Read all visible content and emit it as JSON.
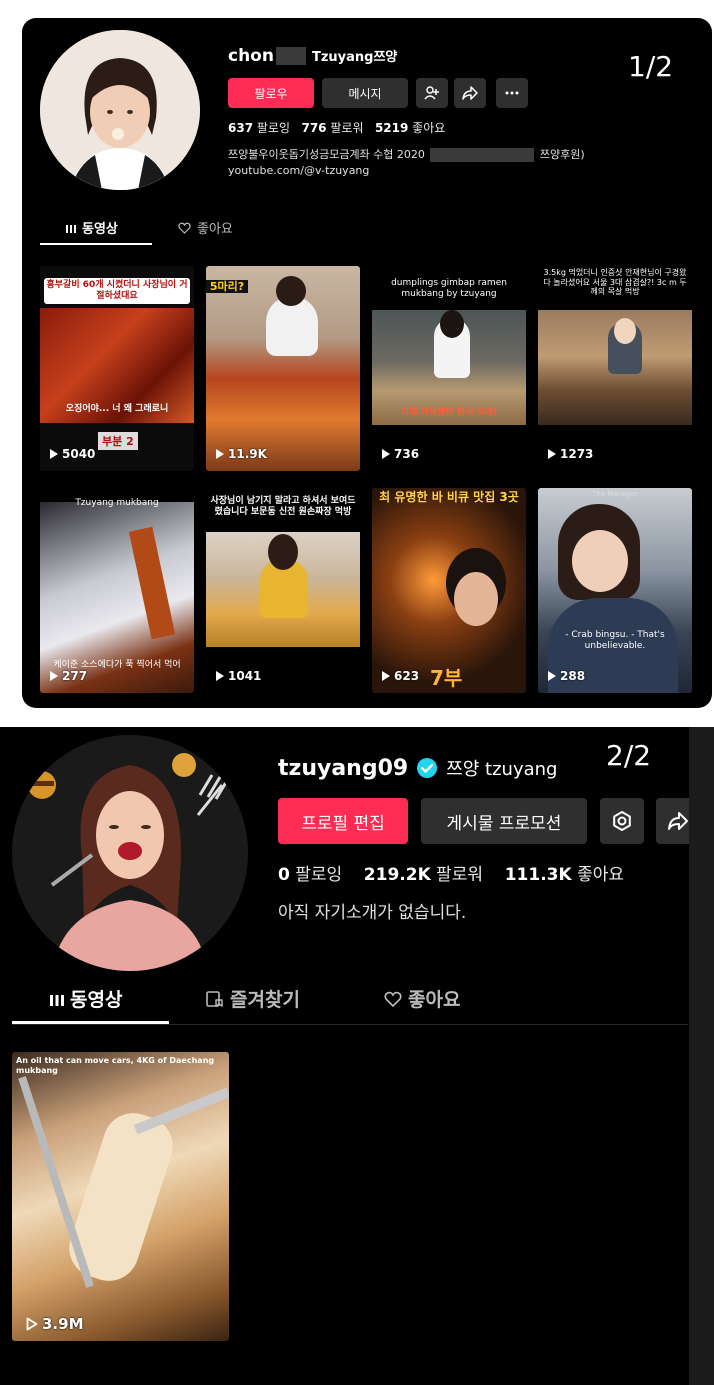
{
  "panel1": {
    "counter": "1/2",
    "username": "chon",
    "display_name": "Tzuyang쯔양",
    "buttons": {
      "follow": "팔로우",
      "message": "메시지"
    },
    "stats": {
      "following_count": "637",
      "following_label": "팔로잉",
      "followers_count": "776",
      "followers_label": "팔로워",
      "likes_count": "5219",
      "likes_label": "좋아요"
    },
    "bio_line1_a": "쯔양불우이웃돕기성금모금계좌 수협 2020",
    "bio_line1_b": "쯔양후원)",
    "bio_line2": "youtube.com/@v-tzuyang",
    "tabs": {
      "videos": "동영상",
      "likes": "좋아요"
    },
    "videos": [
      {
        "views": "5040",
        "caption_top": "흥부갈비 60개 시켰더니 사장님이 거절하셨대요",
        "caption_mid": "오징어야... 너 왜 그래로니",
        "badge": "부분 2"
      },
      {
        "views": "11.9K",
        "caption_top": "5마리?"
      },
      {
        "views": "736",
        "caption_top": "dumplings gimbap ramen mukbang by tzuyang",
        "caption_mid": "기대 가득했던 한식 차례!"
      },
      {
        "views": "1273",
        "caption_top": "3.5kg 먹었더니 인증샷 안재현님이 구경왔다 놀라셨어요 서울 3대 삼겹살?! 3c m 두께의 목살 먹방"
      },
      {
        "views": "277",
        "caption_top": "Tzuyang mukbang",
        "caption_bottom": "케이준 소스에다가 푹 찍어서 먹어"
      },
      {
        "views": "1041",
        "caption_top": "사장님이 남기지 말라고 하셔서 보여드렸습니다 보문동 신전 원손짜장 먹방"
      },
      {
        "views": "623",
        "caption_top": "최 유명한 바 비큐 맛집 3곳",
        "caption_bottom": "7부"
      },
      {
        "views": "288",
        "caption_top": "The Manager",
        "caption_mid": "- Crab bingsu. - That's unbelievable."
      }
    ]
  },
  "panel2": {
    "counter": "2/2",
    "username": "tzuyang09",
    "display_name": "쯔양 tzuyang",
    "buttons": {
      "edit_profile": "프로필 편집",
      "promote": "게시물 프로모션"
    },
    "stats": {
      "following_count": "0",
      "following_label": "팔로잉",
      "followers_count": "219.2K",
      "followers_label": "팔로워",
      "likes_count": "111.3K",
      "likes_label": "좋아요"
    },
    "bio": "아직 자기소개가 없습니다.",
    "tabs": {
      "videos": "동영상",
      "favorites": "즐겨찾기",
      "likes": "좋아요"
    },
    "videos": [
      {
        "views": "3.9M",
        "caption_top": "An oil that can move cars, 4KG of Daechang mukbang"
      }
    ]
  },
  "colors": {
    "accent": "#fe2c55",
    "verified": "#20d5ec",
    "background": "#000000"
  }
}
